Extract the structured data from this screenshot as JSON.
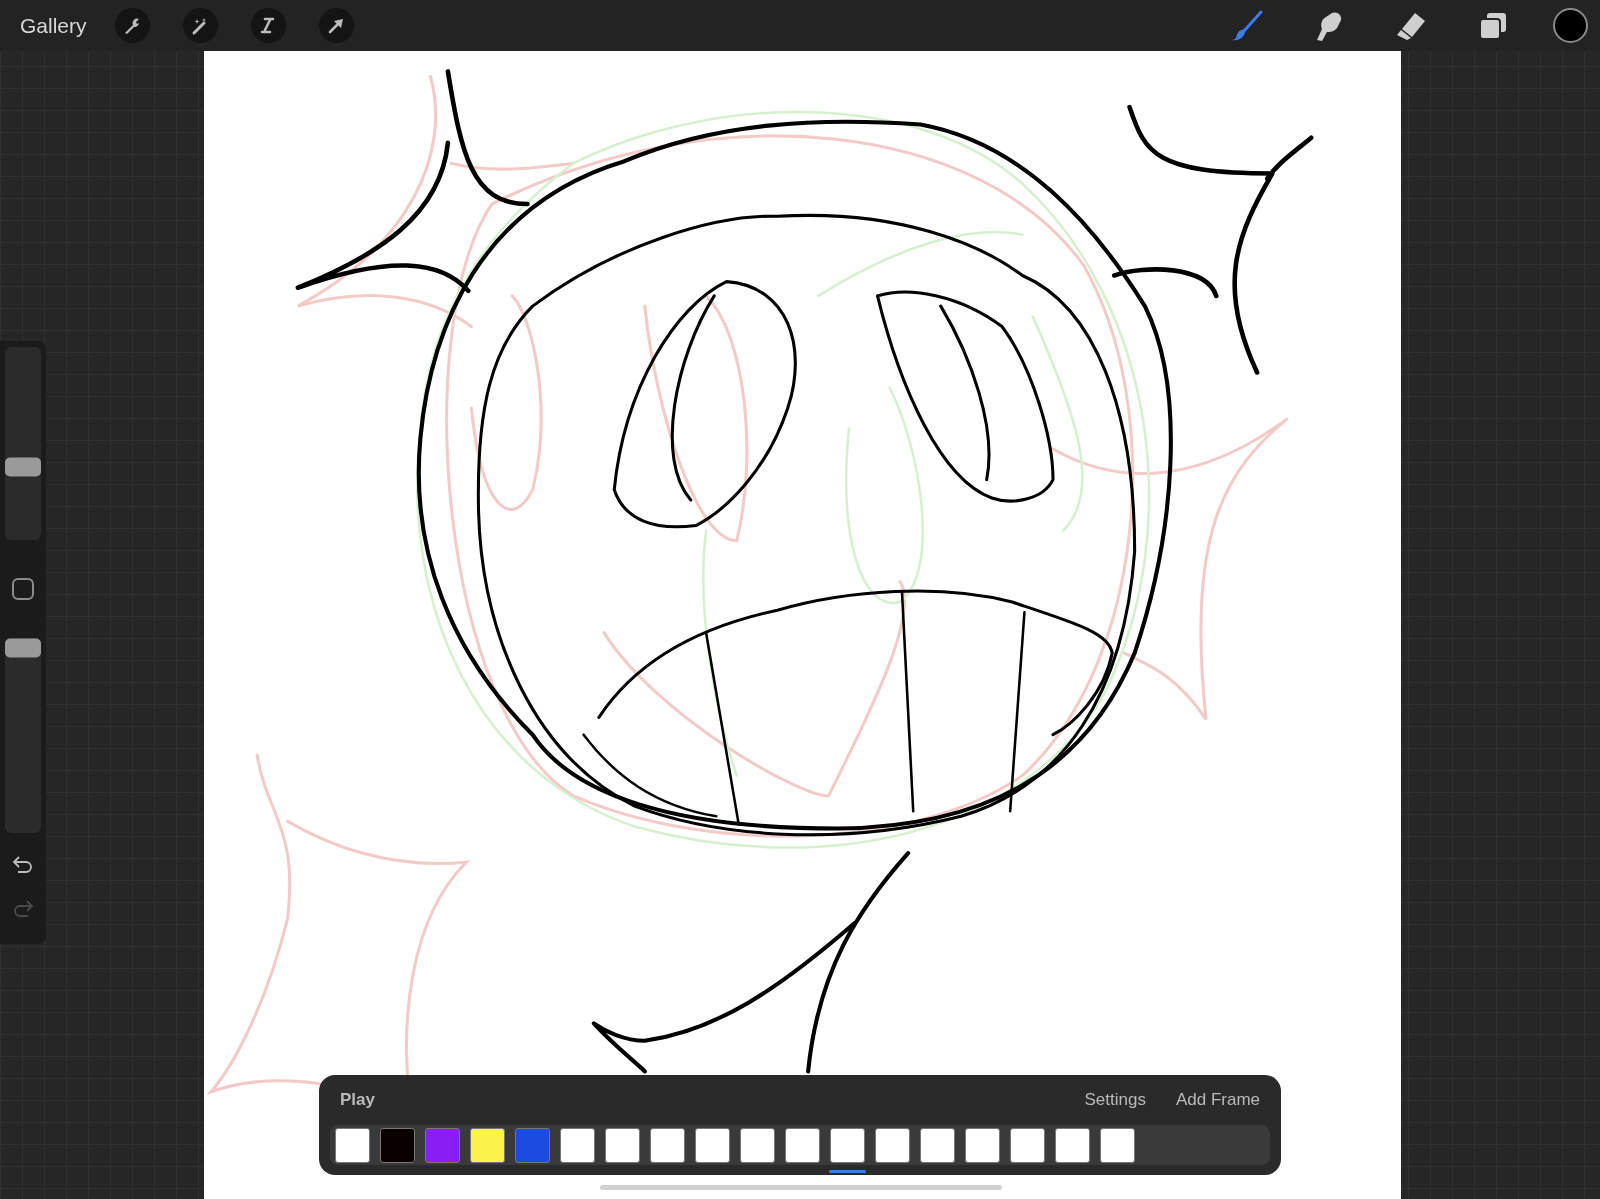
{
  "topbar": {
    "gallery": "Gallery",
    "actions": [
      {
        "kind": "wrench"
      },
      {
        "kind": "wand"
      },
      {
        "kind": "selection"
      },
      {
        "kind": "transform"
      }
    ],
    "tools": [
      {
        "kind": "brush",
        "selected": true
      },
      {
        "kind": "smudge",
        "selected": false
      },
      {
        "kind": "eraser",
        "selected": false
      },
      {
        "kind": "layers",
        "selected": false
      }
    ],
    "color_swatch": true
  },
  "sidebar": {
    "size_slider": {
      "level": 0.38
    },
    "opacity_slider": {
      "level": 0.95
    },
    "undo": {
      "disabled": false
    },
    "redo": {
      "disabled": true
    }
  },
  "timeline": {
    "play": "Play",
    "settings": "Settings",
    "add_frame": "Add Frame",
    "frames": [
      {
        "color": "#ffffff",
        "selected": false
      },
      {
        "color": "#0a0000",
        "selected": false
      },
      {
        "color": "#8a1cf5",
        "selected": false
      },
      {
        "color": "#fbf34a",
        "selected": false
      },
      {
        "color": "#1c4be0",
        "selected": false
      },
      {
        "color": "#ffffff",
        "selected": false
      },
      {
        "color": "#ffffff",
        "selected": false
      },
      {
        "color": "#ffffff",
        "selected": false
      },
      {
        "color": "#ffffff",
        "selected": false
      },
      {
        "color": "#ffffff",
        "selected": false
      },
      {
        "color": "#ffffff",
        "selected": false
      },
      {
        "color": "#ffffff",
        "selected": true
      },
      {
        "color": "#ffffff",
        "selected": false
      },
      {
        "color": "#ffffff",
        "selected": false
      },
      {
        "color": "#ffffff",
        "selected": false
      },
      {
        "color": "#ffffff",
        "selected": false
      },
      {
        "color": "#ffffff",
        "selected": false
      },
      {
        "color": "#ffffff",
        "selected": false
      }
    ]
  }
}
